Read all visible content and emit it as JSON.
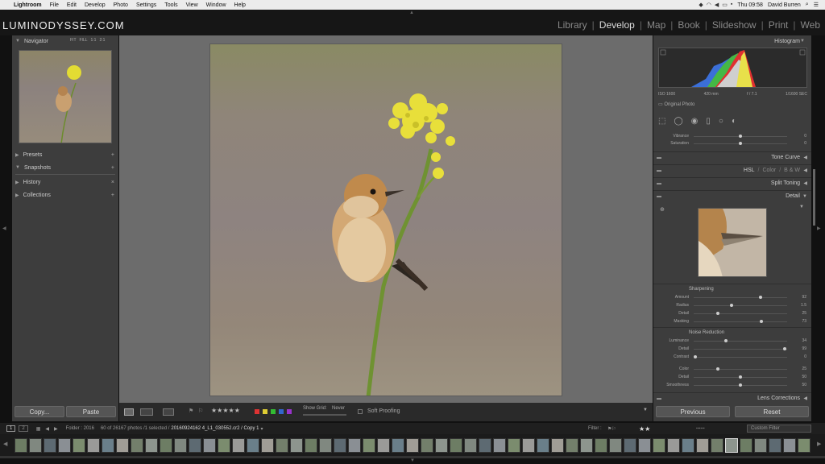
{
  "menubar": {
    "app": "Lightroom",
    "items": [
      "File",
      "Edit",
      "Develop",
      "Photo",
      "Settings",
      "Tools",
      "View",
      "Window",
      "Help"
    ],
    "clock": "Thu 09:58",
    "user": "David Burren"
  },
  "logo": "LUMINODYSSEY.COM",
  "modules": [
    "Library",
    "Develop",
    "Map",
    "Book",
    "Slideshow",
    "Print",
    "Web"
  ],
  "active_module": "Develop",
  "left": {
    "navigator": "Navigator",
    "nav_modes": [
      "FIT",
      "FILL",
      "1:1",
      "2:1"
    ],
    "presets": "Presets",
    "snapshots": "Snapshots",
    "history": "History",
    "collections": "Collections",
    "copy": "Copy...",
    "paste": "Paste"
  },
  "toolbar": {
    "stars": "★★★★★",
    "show_grid_label": "Show Grid:",
    "show_grid_value": "Never",
    "soft_proofing": "Soft Proofing"
  },
  "right": {
    "histogram": "Histogram",
    "iso": "ISO 1600",
    "focal": "420 mm",
    "aperture": "f / 7.1",
    "shutter": "1/1600 SEC",
    "original_photo": "Original Photo",
    "vibrance": {
      "label": "Vibrance",
      "value": "0"
    },
    "saturation": {
      "label": "Saturation",
      "value": "0"
    },
    "tone_curve": "Tone Curve",
    "hsl": "HSL",
    "color": "Color",
    "bw": "B & W",
    "split_toning": "Split Toning",
    "detail": "Detail",
    "sharpening": "Sharpening",
    "sharp": [
      {
        "label": "Amount",
        "value": "92",
        "pos": 0.72
      },
      {
        "label": "Radius",
        "value": "1.5",
        "pos": 0.4
      },
      {
        "label": "Detail",
        "value": "25",
        "pos": 0.25
      },
      {
        "label": "Masking",
        "value": "73",
        "pos": 0.73
      }
    ],
    "noise_reduction": "Noise Reduction",
    "noise": [
      {
        "label": "Luminance",
        "value": "34",
        "pos": 0.34
      },
      {
        "label": "Detail",
        "value": "99",
        "pos": 0.99
      },
      {
        "label": "Contrast",
        "value": "0",
        "pos": 0.0
      }
    ],
    "color_nr": [
      {
        "label": "Color",
        "value": "25",
        "pos": 0.25
      },
      {
        "label": "Detail",
        "value": "50",
        "pos": 0.5
      },
      {
        "label": "Smoothness",
        "value": "50",
        "pos": 0.5
      }
    ],
    "lens_corrections": "Lens Corrections",
    "previous": "Previous",
    "reset": "Reset"
  },
  "filmstrip": {
    "page1": "1",
    "page2": "2",
    "folder": "Folder : 2016",
    "count": "60 of 26167 photos /1 selected /",
    "filename": "20160924162 4_L1_030552.cr2 / Copy 1",
    "filter_label": "Filter :",
    "rating": "★★",
    "custom_filter": "Custom Filter"
  }
}
